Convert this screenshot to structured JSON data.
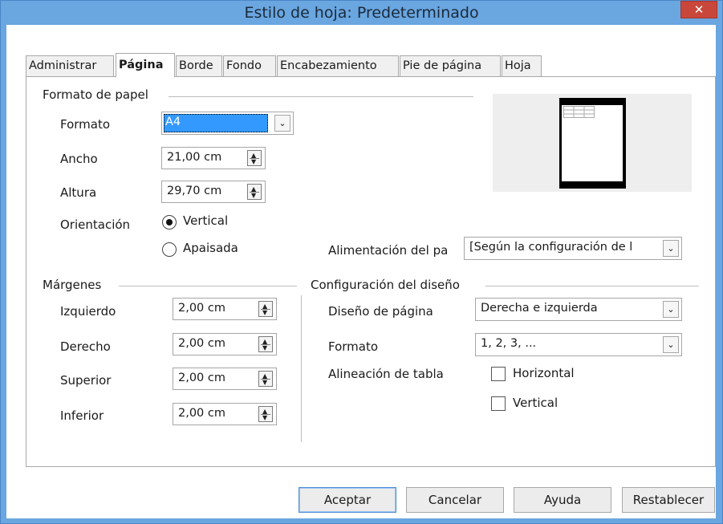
{
  "window": {
    "title": "Estilo de hoja: Predeterminado",
    "close_glyph": "✕"
  },
  "tabs": [
    {
      "label": "Administrar"
    },
    {
      "label": "Página"
    },
    {
      "label": "Borde"
    },
    {
      "label": "Fondo"
    },
    {
      "label": "Encabezamiento"
    },
    {
      "label": "Pie de página"
    },
    {
      "label": "Hoja"
    }
  ],
  "paper": {
    "heading": "Formato de papel",
    "format_label": "Formato",
    "format_value": "A4",
    "width_label": "Ancho",
    "width_value": "21,00 cm",
    "height_label": "Altura",
    "height_value": "29,70 cm",
    "orientation_label": "Orientación",
    "portrait_label": "Vertical",
    "landscape_label": "Apaisada",
    "orientation_selected": "Vertical",
    "tray_label": "Alimentación del pa",
    "tray_value": "[Según la configuración de l"
  },
  "margins": {
    "heading": "Márgenes",
    "left_label": "Izquierdo",
    "left_value": "2,00 cm",
    "right_label": "Derecho",
    "right_value": "2,00 cm",
    "top_label": "Superior",
    "top_value": "2,00 cm",
    "bottom_label": "Inferior",
    "bottom_value": "2,00 cm"
  },
  "layout": {
    "heading": "Configuración del diseño",
    "page_layout_label": "Diseño de página",
    "page_layout_value": "Derecha e izquierda",
    "format_label": "Formato",
    "format_value": "1, 2, 3, ...",
    "table_align_label": "Alineación de tabla",
    "horizontal_label": "Horizontal",
    "vertical_label": "Vertical",
    "horizontal_checked": false,
    "vertical_checked": false
  },
  "buttons": {
    "ok": "Aceptar",
    "cancel": "Cancelar",
    "help": "Ayuda",
    "reset": "Restablecer"
  },
  "colors": {
    "titlebar": "#6aa6e0",
    "close": "#c9473a",
    "selection": "#3399ff"
  }
}
